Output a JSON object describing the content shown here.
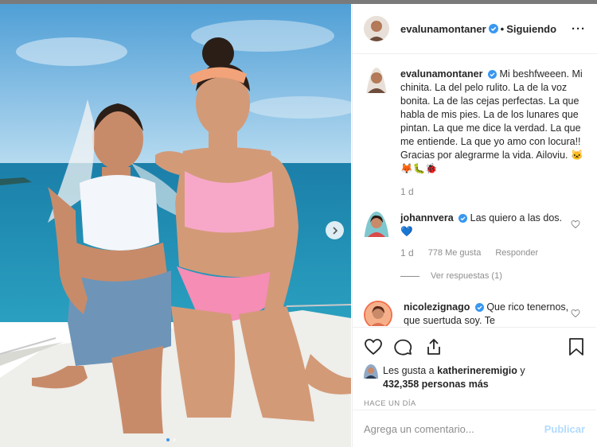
{
  "post": {
    "username": "evalunamontaner",
    "follow_status": "Siguiendo",
    "more_icon": "ellipsis-icon",
    "caption": "Mi beshfweeen. Mi chinita. La del pelo rulito. La de la voz bonita. La de las cejas perfectas. La que habla de mis pies. La de los lunares que pintan. La que me dice la verdad. La que me entiende. La que yo amo con locura!! Gracias por alegrarme la vida. Ailoviu. 🐱🦊🐛🐞",
    "caption_time": "1 d"
  },
  "comments": [
    {
      "username": "johannvera",
      "text": "Las quiero a las dos. 💙",
      "time": "1 d",
      "likes": "778 Me gusta",
      "reply_label": "Responder",
      "view_replies": "Ver respuestas (1)"
    },
    {
      "username": "nicolezignago",
      "text": "Que rico tenernos, que suertuda soy. Te"
    }
  ],
  "likes": {
    "prefix": "Les gusta a",
    "user": "katherineremigio",
    "connector": "y",
    "count": "432,358 personas más"
  },
  "posted_ago": "HACE UN DÍA",
  "add_comment": {
    "placeholder": "Agrega un comentario...",
    "publish_label": "Publicar"
  },
  "colors": {
    "verified": "#3897f0",
    "publish_disabled": "#b3dbff",
    "sea": "#1d8fb4",
    "sky": "#8fc3e6"
  }
}
